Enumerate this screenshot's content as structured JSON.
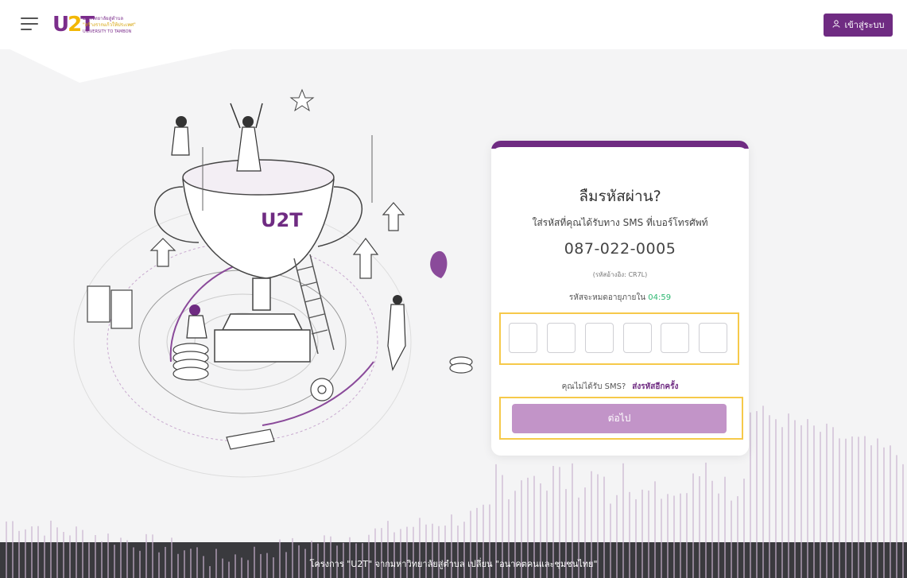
{
  "header": {
    "logo": {
      "mark": "U2T",
      "line1": "มหาวิทยาลัยสู่ตำบล",
      "line2": "\"สร้างรากแก้วให้ประเทศ\"",
      "line3": "UNIVERSITY TO TAMBON"
    },
    "login_button": {
      "label": "เข้าสู่ระบบ",
      "icon": "user-icon"
    },
    "menu_icon": "hamburger-menu-icon"
  },
  "form": {
    "title": "ลืมรหัสผ่าน?",
    "subtitle": "ใส่รหัสที่คุณได้รับทาง SMS ที่เบอร์โทรศัพท์",
    "phone": "087-022-0005",
    "reference": "(รหัสอ้างอิง: CR7L)",
    "expire_label": "รหัสจะหมดอายุภายใน",
    "timer": "04:59",
    "otp_count": 6,
    "resend_question": "คุณไม่ได้รับ SMS?",
    "resend_link": "ส่งรหัสอีกครั้ง",
    "next_button": "ต่อไป"
  },
  "footer": {
    "text": "โครงการ  \"U2T\"  จากมหาวิทยาลัยสู่ตำบล เปลี่ยน \"อนาคตคนและชุมชนไทย\""
  },
  "colors": {
    "brand": "#6f2b82",
    "brand_light": "#c294c8",
    "highlight_outline": "#f6c94a",
    "timer": "#2eb872",
    "footer_bg": "#3a3a3e"
  }
}
